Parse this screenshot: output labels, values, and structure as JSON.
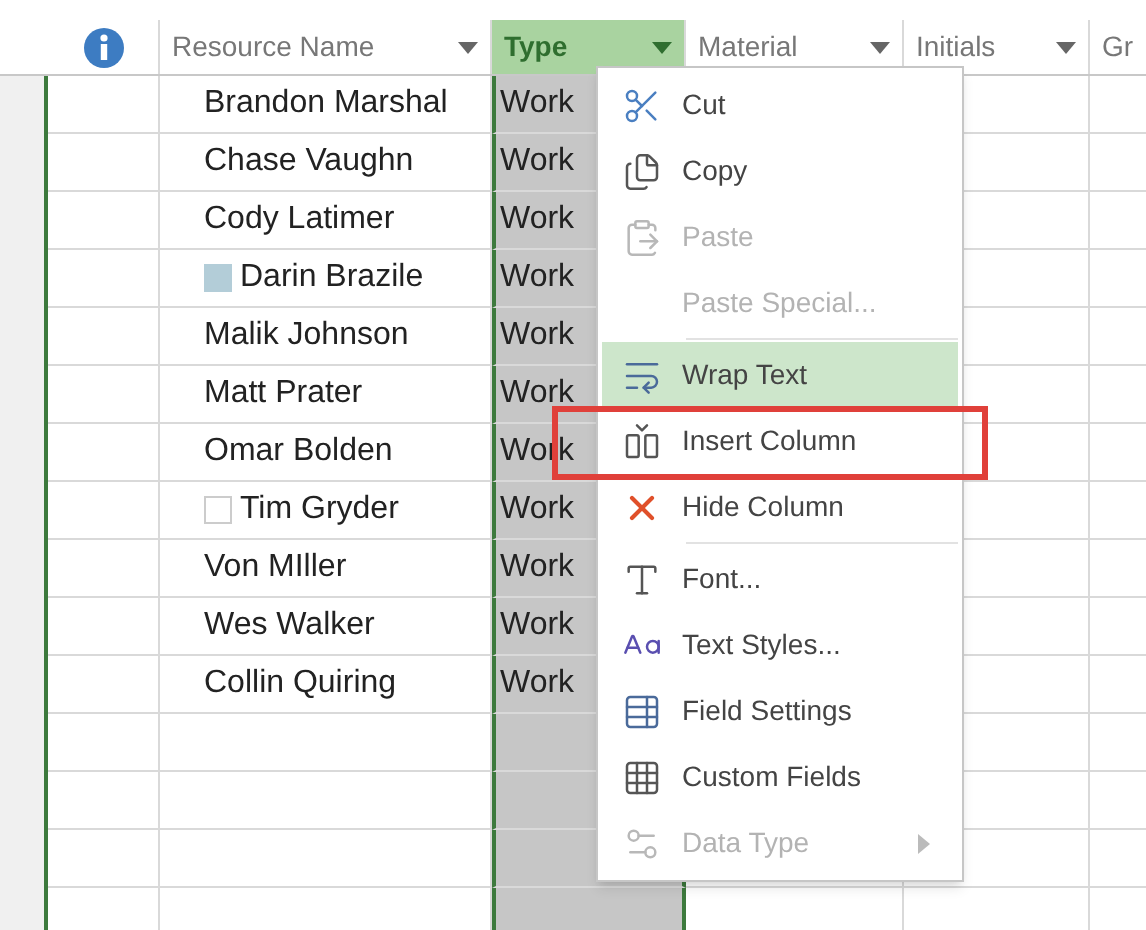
{
  "columns": [
    {
      "label": "Resource Name",
      "selected": false
    },
    {
      "label": "Type",
      "selected": true
    },
    {
      "label": "Material",
      "selected": false
    },
    {
      "label": "Initials",
      "selected": false
    },
    {
      "label": "Gr",
      "selected": false
    }
  ],
  "rows": [
    {
      "name": "Brandon Marshal",
      "type": "Work"
    },
    {
      "name": "Chase Vaughn",
      "type": "Work"
    },
    {
      "name": "Cody Latimer",
      "type": "Work"
    },
    {
      "name": "Darin Brazile",
      "type": "Work",
      "marker_filled": true
    },
    {
      "name": "Malik Johnson",
      "type": "Work"
    },
    {
      "name": "Matt Prater",
      "type": "Work"
    },
    {
      "name": "Omar Bolden",
      "type": "Work"
    },
    {
      "name": "Tim Gryder",
      "type": "Work",
      "marker_filled": false
    },
    {
      "name": "Von MIller",
      "type": "Work"
    },
    {
      "name": "Wes Walker",
      "type": "Work"
    },
    {
      "name": "Collin Quiring",
      "type": "Work"
    }
  ],
  "context_menu": {
    "items": [
      {
        "kind": "item",
        "label": "Cut",
        "disabled": false,
        "highlighted": false,
        "outlined": false
      },
      {
        "kind": "item",
        "label": "Copy",
        "disabled": false,
        "highlighted": false,
        "outlined": false
      },
      {
        "kind": "item",
        "label": "Paste",
        "disabled": true,
        "highlighted": false,
        "outlined": false
      },
      {
        "kind": "item",
        "label": "Paste Special...",
        "disabled": true,
        "highlighted": false,
        "outlined": false
      },
      {
        "kind": "separator"
      },
      {
        "kind": "item",
        "label": "Wrap Text",
        "disabled": false,
        "highlighted": true,
        "outlined": false
      },
      {
        "kind": "item",
        "label": "Insert Column",
        "disabled": false,
        "highlighted": false,
        "outlined": true
      },
      {
        "kind": "item",
        "label": "Hide Column",
        "disabled": false,
        "highlighted": false,
        "outlined": false
      },
      {
        "kind": "separator"
      },
      {
        "kind": "item",
        "label": "Font...",
        "disabled": false,
        "highlighted": false,
        "outlined": false
      },
      {
        "kind": "item",
        "label": "Text Styles...",
        "disabled": false,
        "highlighted": false,
        "outlined": false
      },
      {
        "kind": "item",
        "label": "Field Settings",
        "disabled": false,
        "highlighted": false,
        "outlined": false
      },
      {
        "kind": "item",
        "label": "Custom Fields",
        "disabled": false,
        "highlighted": false,
        "outlined": false
      },
      {
        "kind": "submenu",
        "label": "Data Type",
        "disabled": true,
        "highlighted": false,
        "outlined": false
      }
    ]
  }
}
